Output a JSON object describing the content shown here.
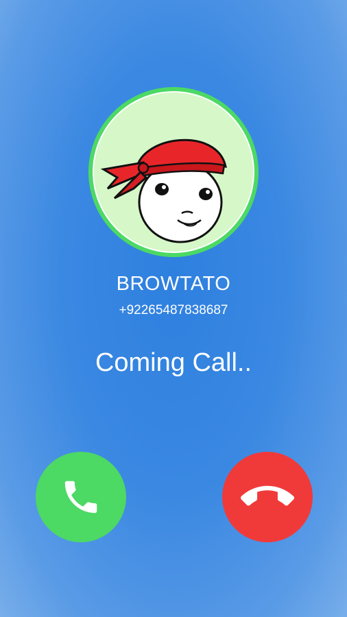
{
  "caller": {
    "name": "BROWTATO",
    "number": "+92265487838687"
  },
  "call": {
    "status": "Coming Call.."
  },
  "actions": {
    "accept_icon": "phone-icon",
    "decline_icon": "phone-hangup-icon"
  },
  "colors": {
    "background": "#3a88e2",
    "accept": "#4cd964",
    "decline": "#f03a3a",
    "avatar_ring": "#4cd964",
    "avatar_fill": "#d6f7c8",
    "bandana": "#e8262a"
  }
}
